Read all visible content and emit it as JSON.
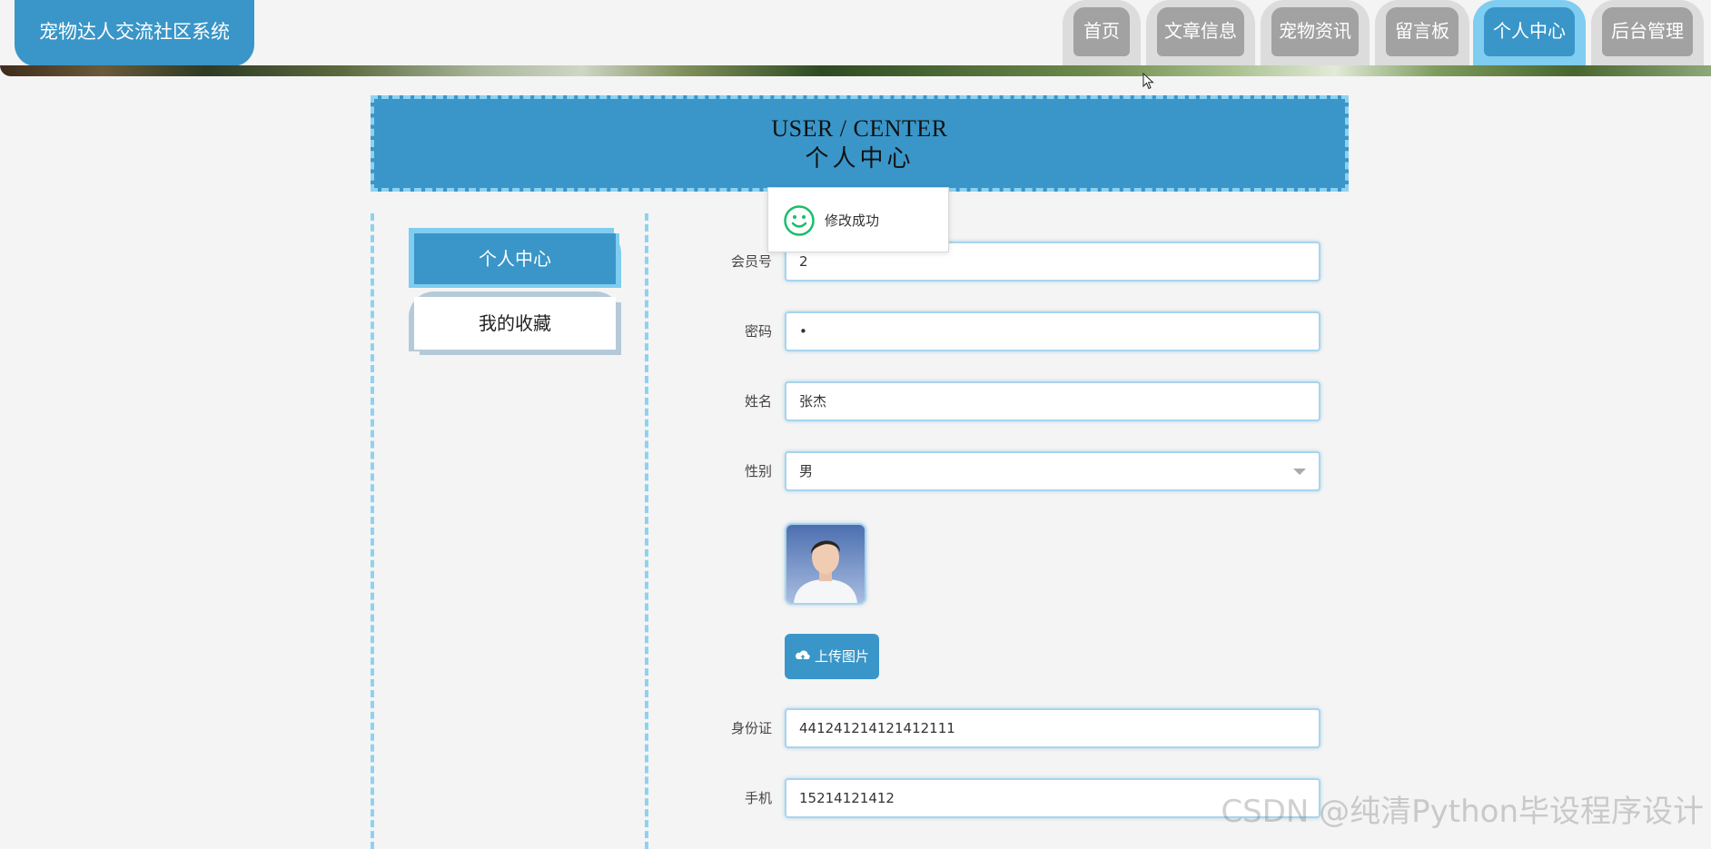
{
  "site": {
    "title": "宠物达人交流社区系统"
  },
  "nav": {
    "items": [
      {
        "label": "首页",
        "active": false
      },
      {
        "label": "文章信息",
        "active": false
      },
      {
        "label": "宠物资讯",
        "active": false
      },
      {
        "label": "留言板",
        "active": false
      },
      {
        "label": "个人中心",
        "active": true
      },
      {
        "label": "后台管理",
        "active": false
      }
    ]
  },
  "page": {
    "title_en": "USER / CENTER",
    "title_cn": "个人中心"
  },
  "sidebar": {
    "items": [
      {
        "label": "个人中心",
        "active": true
      },
      {
        "label": "我的收藏",
        "active": false
      }
    ]
  },
  "toast": {
    "icon": "smile-icon",
    "message": "修改成功"
  },
  "form": {
    "member_no": {
      "label": "会员号",
      "value": "2"
    },
    "password": {
      "label": "密码",
      "value": "•"
    },
    "name": {
      "label": "姓名",
      "value": "张杰"
    },
    "gender": {
      "label": "性别",
      "value": "男"
    },
    "upload": {
      "label": "上传图片",
      "icon": "cloud-upload-icon"
    },
    "id_card": {
      "label": "身份证",
      "value": "441241214121412111"
    },
    "phone": {
      "label": "手机",
      "value": "15214121412"
    }
  },
  "watermark": "CSDN @纯清Python毕设程序设计",
  "colors": {
    "primary": "#3a96c8",
    "accent_light": "#7fcdf0",
    "nav_inactive": "#a2a2a2",
    "nav_frame": "#dcdcdc",
    "background": "#f4f4f4",
    "success": "#19be6b"
  }
}
